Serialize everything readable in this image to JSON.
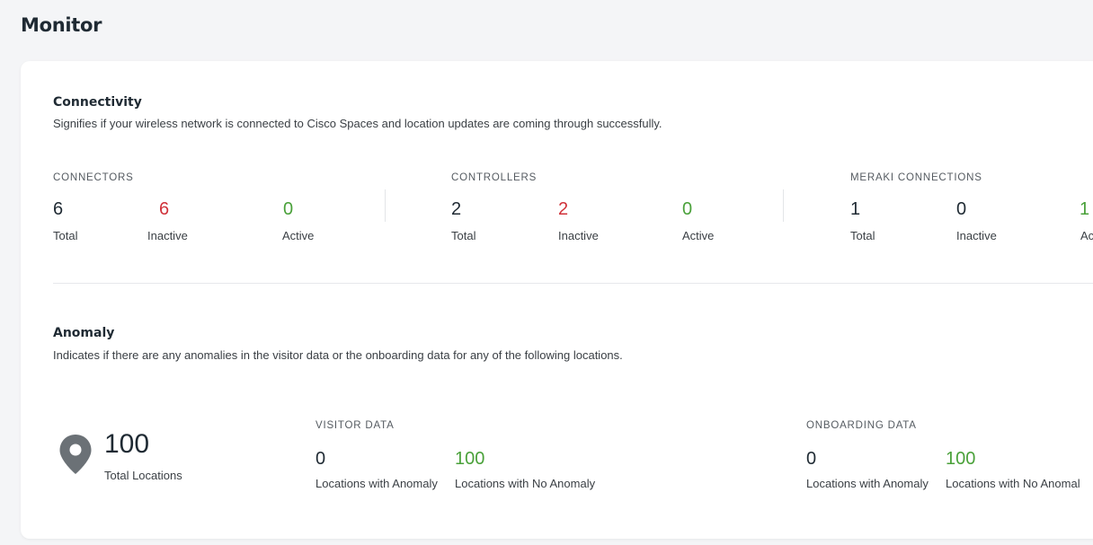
{
  "page": {
    "title": "Monitor"
  },
  "connectivity": {
    "title": "Connectivity",
    "description": "Signifies if your wireless network is connected to Cisco Spaces and location updates are coming through successfully.",
    "groups": [
      {
        "label": "CONNECTORS",
        "total": "6",
        "inactive": "6",
        "active": "0",
        "total_label": "Total",
        "inactive_label": "Inactive",
        "active_label": "Active"
      },
      {
        "label": "CONTROLLERS",
        "total": "2",
        "inactive": "2",
        "active": "0",
        "total_label": "Total",
        "inactive_label": "Inactive",
        "active_label": "Active"
      },
      {
        "label": "MERAKI CONNECTIONS",
        "total": "1",
        "inactive": "0",
        "active": "1",
        "total_label": "Total",
        "inactive_label": "Inactive",
        "active_label": "Ac"
      }
    ]
  },
  "anomaly": {
    "title": "Anomaly",
    "description": "Indicates if there are any anomalies in the visitor data or the onboarding data for any of the following locations.",
    "total_locations": {
      "value": "100",
      "label": "Total Locations",
      "icon": "location-pin-icon"
    },
    "visitor": {
      "label": "VISITOR DATA",
      "with_anomaly": "0",
      "no_anomaly": "100",
      "with_label": "Locations with Anomaly",
      "no_label": "Locations with No Anomaly"
    },
    "onboarding": {
      "label": "ONBOARDING DATA",
      "with_anomaly": "0",
      "no_anomaly": "100",
      "with_label": "Locations with Anomaly",
      "no_label": "Locations with No Anomal"
    }
  },
  "colors": {
    "inactive": "#d0323a",
    "active": "#4aa13a",
    "pin": "#6b7176"
  }
}
